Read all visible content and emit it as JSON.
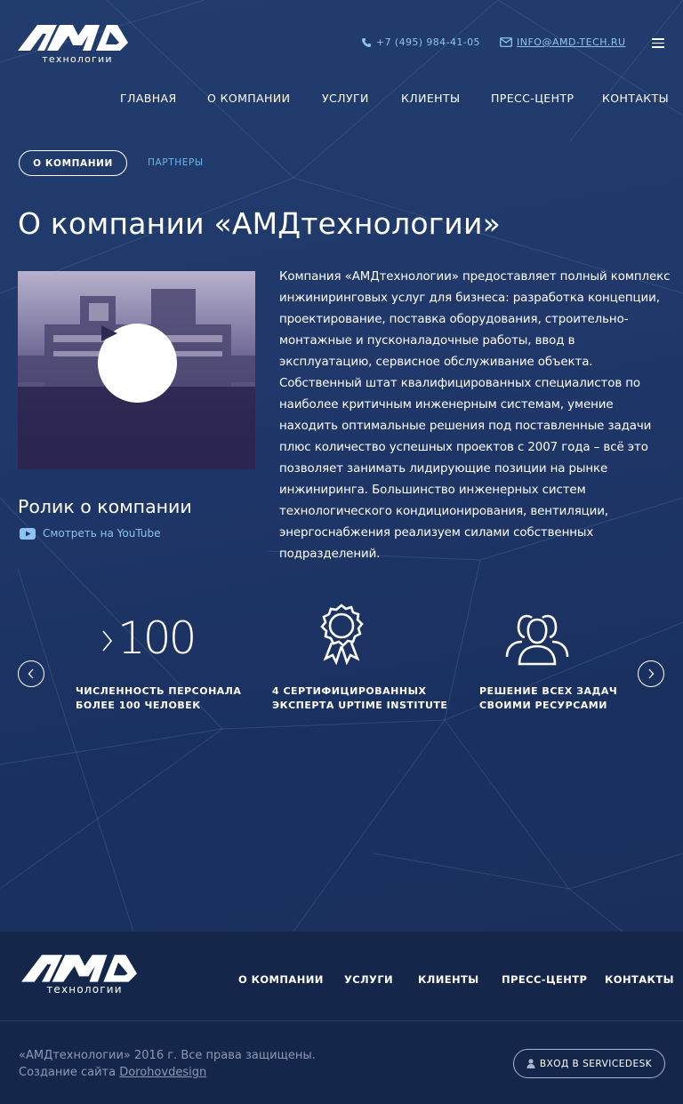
{
  "header": {
    "logo_text": "AMD",
    "logo_subtitle": "технологии",
    "phone": "+7 (495) 984-41-05",
    "email": "INFO@AMD-TECH.RU"
  },
  "nav": {
    "items": [
      "ГЛАВНАЯ",
      "О КОМПАНИИ",
      "УСЛУГИ",
      "КЛИЕНТЫ",
      "ПРЕСС-ЦЕНТР",
      "КОНТАКТЫ"
    ]
  },
  "subnav": {
    "active": "О КОМПАНИИ",
    "partners": "ПАРТНЕРЫ"
  },
  "page_title": "О компании «АМДтехнологии»",
  "video": {
    "title": "Ролик о компании",
    "youtube_link": "Смотреть на YouTube"
  },
  "about_text": "Компания «АМДтехнологии» предоставляет полный комплекс инжиниринговых услуг для бизнеса: разработка концепции, проектирование, поставка оборудования, строительно-монтажные и пусконаладочные работы, ввод в эксплуатацию, сервисное обслуживание объекта. Собственный штат квалифицированных специалистов по наиболее критичным инженерным системам, умение находить оптимальные решения под  поставленные задачи плюс количество успешных проектов с 2007 года – всё это позволяет занимать лидирующие позиции на рынке инжиниринга. Большинство инженерных систем технологического кондиционирования, вентиляции, энергоснабжения реализуем силами собственных подразделений.",
  "stats": {
    "staff_number": "100",
    "staff_label_1": "ЧИСЛЕННОСТЬ ПЕРСОНАЛА",
    "staff_label_2": "БОЛЕЕ 100 ЧЕЛОВЕК",
    "cert_label_1": "4 СЕРТИФИЦИРОВАННЫХ",
    "cert_label_2": "ЭКСПЕРТА UPTIME INSTITUTE",
    "resources_label_1": "РЕШЕНИЕ ВСЕХ ЗАДАЧ",
    "resources_label_2": "СВОИМИ РЕСУРСАМИ"
  },
  "footer": {
    "nav": [
      "О КОМПАНИИ",
      "УСЛУГИ",
      "КЛИЕНТЫ",
      "ПРЕСС-ЦЕНТР",
      "КОНТАКТЫ"
    ],
    "copyright": "«АМДтехнологии» 2016 г. Все права защищены.",
    "made_by_prefix": "Создание сайта ",
    "made_by_link": "Dorohovdesign",
    "servicedesk_button": "ВХОД В SERVICEDESK"
  },
  "colors": {
    "background": "#1f3868",
    "footer": "#14274a",
    "link": "#8fc4f0"
  }
}
